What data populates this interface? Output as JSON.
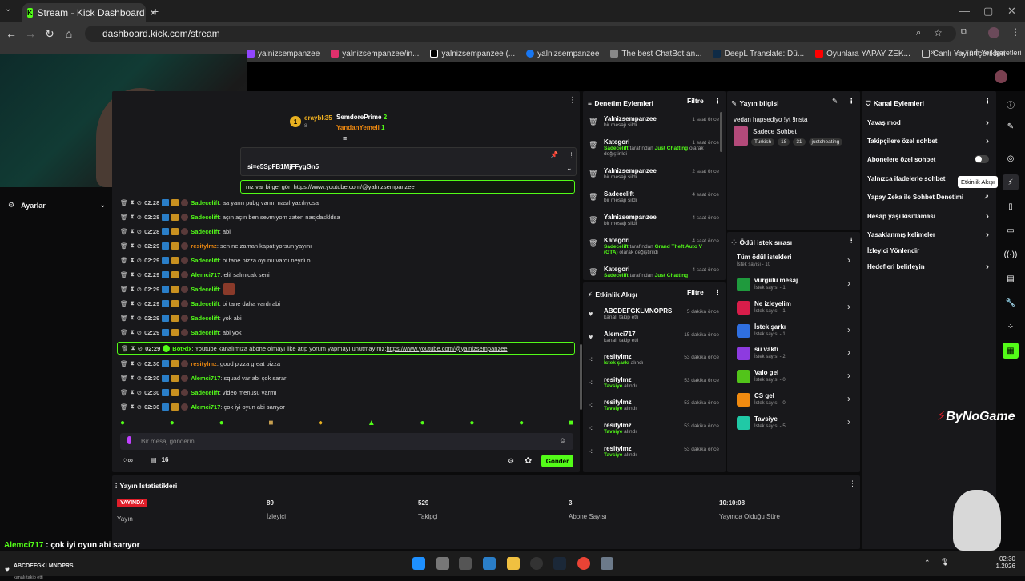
{
  "browser": {
    "tab_title": "Stream - Kick Dashboard",
    "url": "dashboard.kick.com/stream",
    "bookmarks": [
      "yalnizsempanzee",
      "yalnizsempanzee/in...",
      "yalnizsempanzee (...",
      "yalnizsempanzee",
      "The best ChatBot an...",
      "DeepL Translate: Dü...",
      "Oyunlara YAPAY ZEK...",
      "Canlı Yayın İçerikleri"
    ],
    "bookmarks_all": "Tüm Yer İşaretleri"
  },
  "sidebar": {
    "settings": "Ayarlar"
  },
  "chat": {
    "top_gifters": [
      {
        "rank": "1",
        "name": "eraybk35",
        "count": "8"
      },
      {
        "name": "SemdorePrime",
        "count": "2"
      },
      {
        "name": "YandanYemeli",
        "count": "1"
      }
    ],
    "pinned_link": "si=e5SpFB1MjFFygGn5",
    "first_line": "nız var bi gel gör: ",
    "first_link": "https://www.youtube.com/@yalnizsempanzee",
    "messages": [
      {
        "time": "02:28",
        "user": "Sadecelift",
        "text": ": aa yarın pubg varmı nasıl yazılıyosa"
      },
      {
        "time": "02:28",
        "user": "Sadecelift",
        "text": ": açın açın ben sevmiyom zaten nasjdaskldsa"
      },
      {
        "time": "02:28",
        "user": "Sadecelift",
        "text": ": abi"
      },
      {
        "time": "02:29",
        "user": "resitylmz",
        "text": ": sen ne zaman kapatıyorsun yayını"
      },
      {
        "time": "02:29",
        "user": "Sadecelift",
        "text": ": bi tane pizza oyunu vardı neydi o"
      },
      {
        "time": "02:29",
        "user": "Alemci717",
        "text": ": elif salmıcak seni"
      },
      {
        "time": "02:29",
        "user": "Sadecelift",
        "text": ":"
      },
      {
        "time": "02:29",
        "user": "Sadecelift",
        "text": ": bi tane daha vardı abi"
      },
      {
        "time": "02:29",
        "user": "Sadecelift",
        "text": ": yok abi"
      },
      {
        "time": "02:29",
        "user": "Sadecelift",
        "text": ": abi yok"
      },
      {
        "time": "02:29",
        "user": "BotRix",
        "text": ": Youtube kanalımıza abone olmayı like atıp yorum yapmayı unutmayınız: ",
        "link": "https://www.youtube.com/@yalnizsempanzee"
      },
      {
        "time": "02:30",
        "user": "resitylmz",
        "text": ": good pizza great pizza"
      },
      {
        "time": "02:30",
        "user": "Alemci717",
        "text": ": squad var abi çok sarar"
      },
      {
        "time": "02:30",
        "user": "Sadecelift",
        "text": ": video menüsü varmı"
      },
      {
        "time": "02:30",
        "user": "Alemci717",
        "text": ": çok iyi oyun abi sarıyor"
      }
    ],
    "input_placeholder": "Bir mesaj gönderin",
    "viewer_count": "16",
    "send_label": "Gönder"
  },
  "mod_actions": {
    "title": "Denetim Eylemleri",
    "filter": "Filtre",
    "items": [
      {
        "name": "Yalnizsempanzee",
        "time": "1 saat önce",
        "sub": "bir mesajı sildi"
      },
      {
        "name": "Kategori",
        "time": "1 saat önce",
        "sub_user": "Sadecelift",
        "sub": " tarafından ",
        "sub_cat": "Just Chatting",
        "sub2": " olarak değiştirildi"
      },
      {
        "name": "Yalnizsempanzee",
        "time": "2 saat önce",
        "sub": "bir mesajı sildi"
      },
      {
        "name": "Sadecelift",
        "time": "4 saat önce",
        "sub": "bir mesajı sildi"
      },
      {
        "name": "Yalnizsempanzee",
        "time": "4 saat önce",
        "sub": "bir mesajı sildi"
      },
      {
        "name": "Kategori",
        "time": "4 saat önce",
        "sub_user": "Sadecelift",
        "sub": " tarafından ",
        "sub_cat": "Grand Theft Auto V (GTA)",
        "sub2": " olarak değiştirildi"
      },
      {
        "name": "Kategori",
        "time": "4 saat önce",
        "sub_user": "Sadecelift",
        "sub": " tarafından ",
        "sub_cat": "Just Chatting",
        "sub2": ""
      }
    ]
  },
  "activity": {
    "title": "Etkinlik Akışı",
    "filter": "Filtre",
    "items": [
      {
        "name": "ABCDEFGKLMNOPRS",
        "time": "5 dakika önce",
        "sub": "kanalı takip etti"
      },
      {
        "name": "Alemci717",
        "time": "15 dakika önce",
        "sub": "kanalı takip etti"
      },
      {
        "name": "resitylmz",
        "time": "53 dakika önce",
        "sub_g": "İstek şarkı",
        "sub": " alındı"
      },
      {
        "name": "resitylmz",
        "time": "53 dakika önce",
        "sub_g": "Tavsiye",
        "sub": " alındı"
      },
      {
        "name": "resitylmz",
        "time": "53 dakika önce",
        "sub_g": "Tavsiye",
        "sub": " alındı"
      },
      {
        "name": "resitylmz",
        "time": "53 dakika önce",
        "sub_g": "Tavsiye",
        "sub": " alındı"
      },
      {
        "name": "resitylmz",
        "time": "53 dakika önce",
        "sub_g": "Tavsiye",
        "sub": " alındı"
      }
    ]
  },
  "stream_info": {
    "title": "Yayın bilgisi",
    "stream_title": "vedan hapsediyo !yt !insta",
    "category": "Sadece Sohbet",
    "tags": [
      "Turkish",
      "18",
      "31",
      "justcheating"
    ]
  },
  "rewards": {
    "title": "Ödül istek sırası",
    "all": "Tüm ödül istekleri",
    "all_count": "İstek sayısı - 10",
    "items": [
      {
        "name": "vurgulu mesaj",
        "count": "İstek sayısı - 1",
        "color": "#1f9a3d"
      },
      {
        "name": "Ne izleyelim",
        "count": "İstek sayısı - 1",
        "color": "#d81d4a"
      },
      {
        "name": "İstek şarkı",
        "count": "İstek sayısı - 1",
        "color": "#2f6fe0"
      },
      {
        "name": "su vakti",
        "count": "İstek sayısı - 2",
        "color": "#8d3be0"
      },
      {
        "name": "Valo gel",
        "count": "İstek sayısı - 0",
        "color": "#52c41a"
      },
      {
        "name": "CS gel",
        "count": "İstek sayısı - 0",
        "color": "#f08a10"
      },
      {
        "name": "Tavsiye",
        "count": "İstek sayısı - 5",
        "color": "#20c9a6"
      }
    ]
  },
  "channel_actions": {
    "title": "Kanal Eylemleri",
    "items": [
      "Yavaş mod",
      "Takipçilere özel sohbet",
      "Abonelere özel sohbet",
      "Yalnızca ifadelerle sohbet",
      "Yapay Zeka ile Sohbet Denetimi",
      "Hesap yaşı kısıtlaması",
      "Yasaklanmış kelimeler",
      "İzleyici Yönlendir",
      "Hedefleri belirleyin"
    ],
    "tooltip": "Etkinlik Akışı"
  },
  "stats": {
    "title": "Yayın İstatistikleri",
    "live": "YAYINDA",
    "live_label": "Yayın",
    "viewers": "89",
    "viewers_label": "İzleyici",
    "followers": "529",
    "followers_label": "Takipçi",
    "subs": "3",
    "subs_label": "Abone Sayısı",
    "duration": "10:10:08",
    "duration_label": "Yayında Olduğu Süre"
  },
  "overlay": {
    "chat_user": "Alemci717",
    "chat_text": " : çok iyi oyun abi sarıyor",
    "follow_name": "ABCDEFGKLMNOPRS",
    "follow_sub": "kanalı takip etti",
    "brand": "ByNoGame"
  },
  "clock": {
    "time": "02:30",
    "date": "1.2026"
  }
}
